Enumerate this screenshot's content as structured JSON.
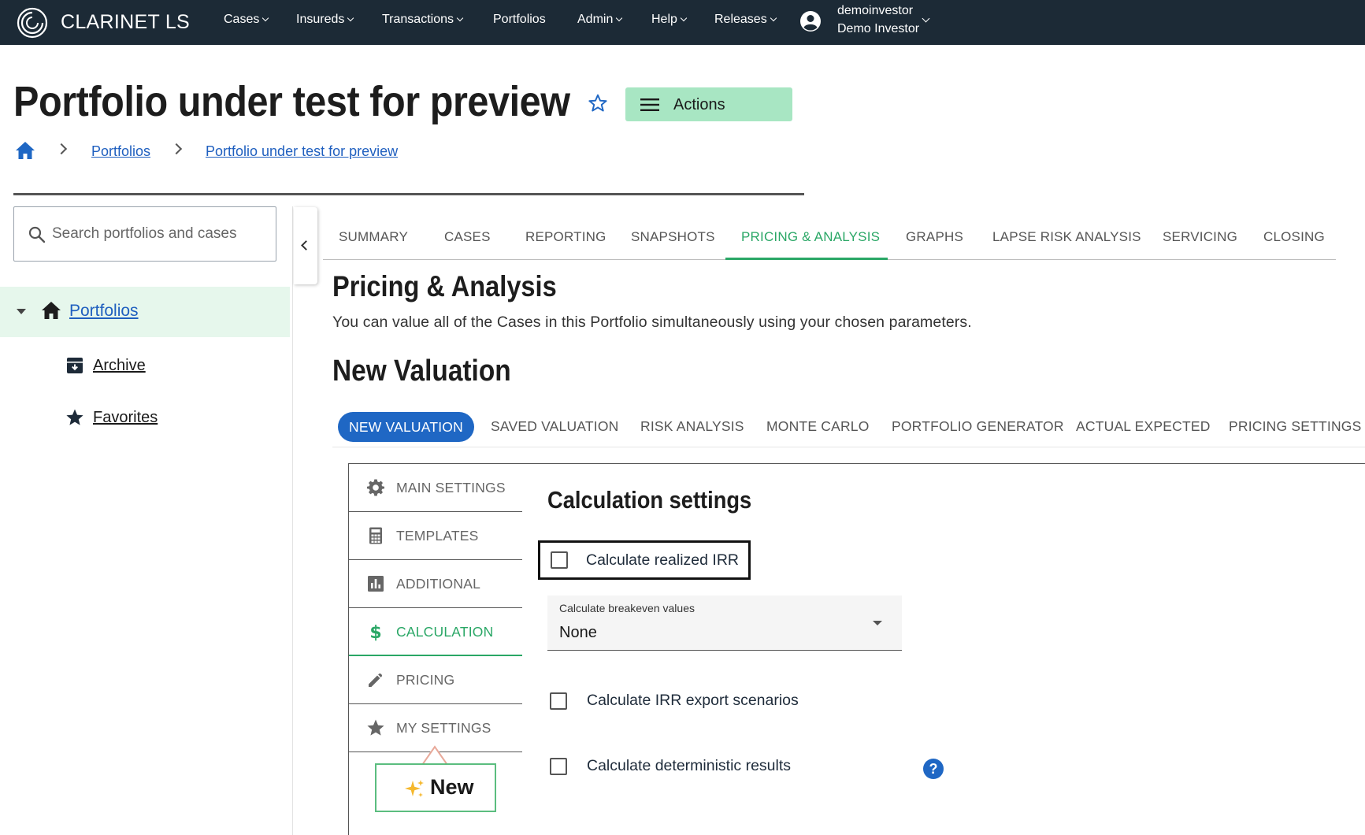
{
  "brand": {
    "name": "CLARINET LS"
  },
  "nav": {
    "items": [
      {
        "label": "Cases",
        "has_dropdown": true
      },
      {
        "label": "Insureds",
        "has_dropdown": true
      },
      {
        "label": "Transactions",
        "has_dropdown": true
      },
      {
        "label": "Portfolios",
        "has_dropdown": false
      },
      {
        "label": "Admin",
        "has_dropdown": true
      },
      {
        "label": "Help",
        "has_dropdown": true
      },
      {
        "label": "Releases",
        "has_dropdown": true
      }
    ],
    "user": {
      "username": "demoinvestor",
      "display_name": "Demo Investor"
    }
  },
  "header": {
    "title": "Portfolio under test for preview",
    "actions_label": "Actions",
    "breadcrumb": [
      "Portfolios",
      "Portfolio under test for preview"
    ]
  },
  "sidebar": {
    "search_placeholder": "Search portfolios and cases",
    "root": "Portfolios",
    "items": [
      {
        "label": "Archive",
        "icon": "archive-icon"
      },
      {
        "label": "Favorites",
        "icon": "star-icon"
      }
    ]
  },
  "main_tabs": [
    "SUMMARY",
    "CASES",
    "REPORTING",
    "SNAPSHOTS",
    "PRICING & ANALYSIS",
    "GRAPHS",
    "LAPSE RISK ANALYSIS",
    "SERVICING",
    "CLOSING"
  ],
  "main_tab_active": "PRICING & ANALYSIS",
  "section": {
    "title": "Pricing & Analysis",
    "description": "You can value all of the Cases in this Portfolio simultaneously using your chosen parameters.",
    "subtitle": "New Valuation"
  },
  "sub_tabs": [
    "NEW VALUATION",
    "SAVED VALUATION",
    "RISK ANALYSIS",
    "MONTE CARLO",
    "PORTFOLIO GENERATOR",
    "ACTUAL EXPECTED",
    "PRICING SETTINGS"
  ],
  "sub_tab_active": "NEW VALUATION",
  "settings_tabs": [
    {
      "label": "MAIN SETTINGS",
      "icon": "gear-icon"
    },
    {
      "label": "TEMPLATES",
      "icon": "calculator-icon"
    },
    {
      "label": "ADDITIONAL",
      "icon": "bar-chart-icon"
    },
    {
      "label": "CALCULATION",
      "icon": "dollar-icon"
    },
    {
      "label": "PRICING",
      "icon": "pencil-icon"
    },
    {
      "label": "MY SETTINGS",
      "icon": "star-icon"
    }
  ],
  "settings_tab_active": "CALCULATION",
  "new_callout": {
    "label": "New",
    "icon": "sparkles-icon"
  },
  "calculation": {
    "title": "Calculation settings",
    "realized_irr": {
      "label": "Calculate realized IRR",
      "checked": false
    },
    "breakeven": {
      "label": "Calculate breakeven values",
      "value": "None"
    },
    "irr_export": {
      "label": "Calculate IRR export scenarios",
      "checked": false
    },
    "deterministic": {
      "label": "Calculate deterministic results",
      "checked": false
    }
  },
  "colors": {
    "navbar": "#1c2a36",
    "accent_green": "#2aa766",
    "actions_bg": "#a8e6c3",
    "primary_blue": "#1f67c4",
    "link_blue": "#1f5fbf"
  }
}
